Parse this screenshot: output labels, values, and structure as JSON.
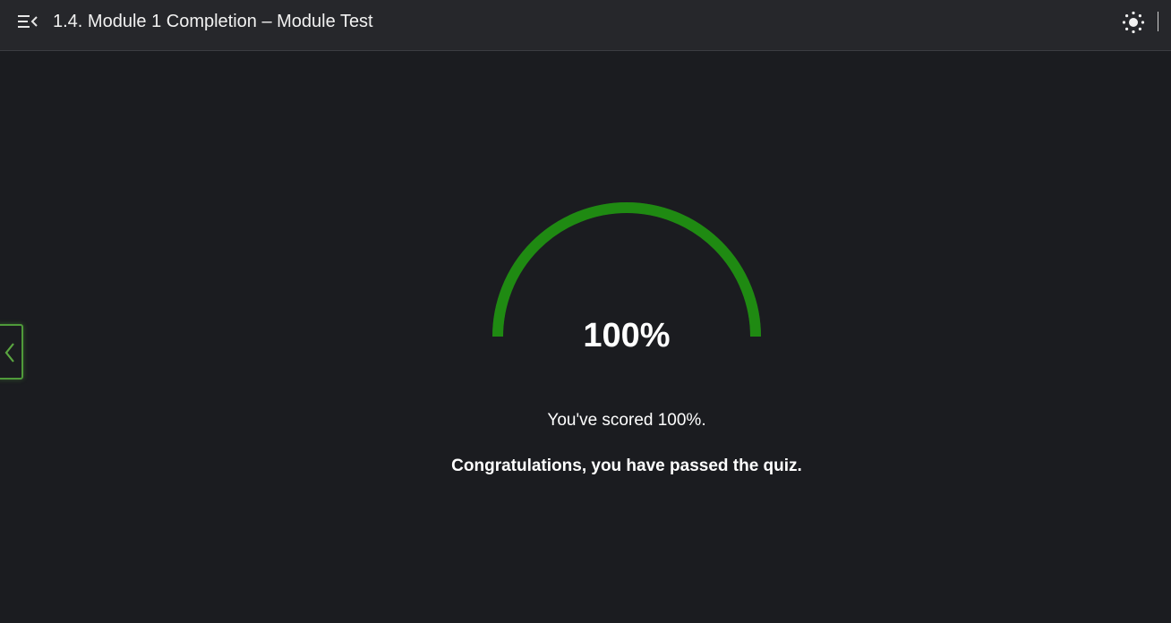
{
  "header": {
    "menu_icon": "menu-collapse-icon",
    "title": "1.4. Module 1 Completion – Module Test",
    "theme_icon": "sun-icon"
  },
  "navigation": {
    "prev_icon": "chevron-left-icon"
  },
  "result": {
    "score_percent": 100,
    "score_display": "100%",
    "score_message": "You've scored 100%.",
    "pass_message": "Congratulations, you have passed the quiz."
  },
  "colors": {
    "background": "#1b1c20",
    "header_background": "#26272b",
    "gauge_fill": "#1f8a12",
    "nav_accent": "#4f9a3a",
    "text": "#ffffff"
  }
}
